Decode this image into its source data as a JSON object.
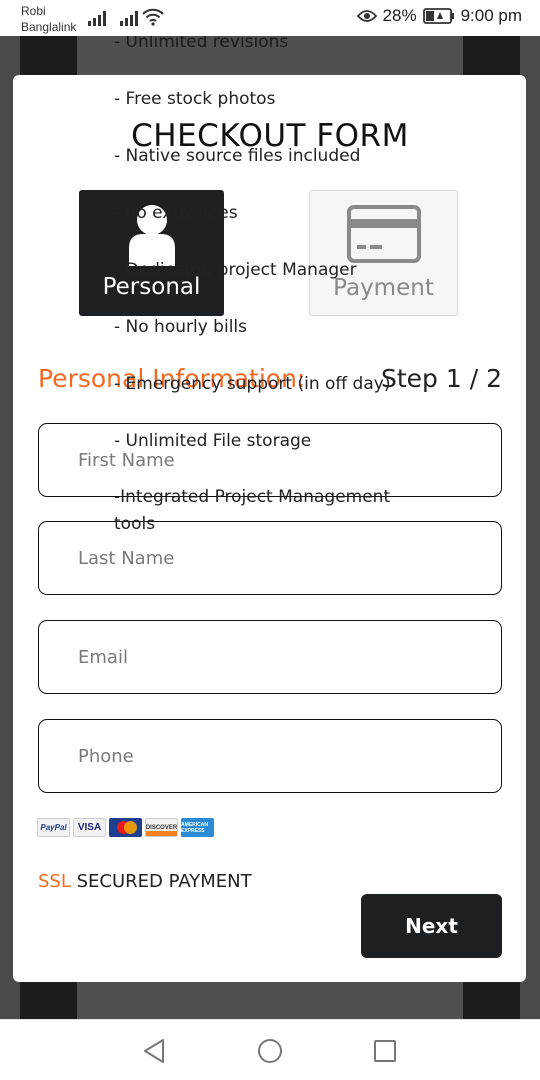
{
  "status_bar": {
    "carrier_line1": "Robi",
    "carrier_line2": "Banglalink",
    "battery": "28%",
    "time": "9:00 pm"
  },
  "modal": {
    "title": "CHECKOUT FORM",
    "steps": [
      {
        "label": "Personal",
        "icon": "user-icon",
        "active": true
      },
      {
        "label": "Payment",
        "icon": "credit-card-icon",
        "active": false
      }
    ],
    "section_heading": "Personal Information:",
    "step_counter": "Step 1 / 2",
    "fields": {
      "first_name_placeholder": "First Name",
      "last_name_placeholder": "Last Name",
      "email_placeholder": "Email",
      "phone_placeholder": "Phone"
    },
    "payment_logos": [
      "PayPal",
      "VISA",
      "MasterCard",
      "DISCOVER",
      "AMERICAN EXPRESS"
    ],
    "ssl_accent": "SSL",
    "ssl_text": " SECURED PAYMENT",
    "next_label": "Next"
  },
  "overlay_features": [
    "- Unlimited revisions",
    "- Free stock photos",
    "- Native source files included",
    "- no extra fees",
    "- Dedicated project Manager",
    "- No hourly bills",
    "- Emergency support (in off day)",
    "- Unlimited File storage",
    "-Integrated Project Management tools"
  ],
  "colors": {
    "accent": "#f26a21",
    "dark": "#1d2023",
    "backdrop": "#4a4a4a"
  }
}
